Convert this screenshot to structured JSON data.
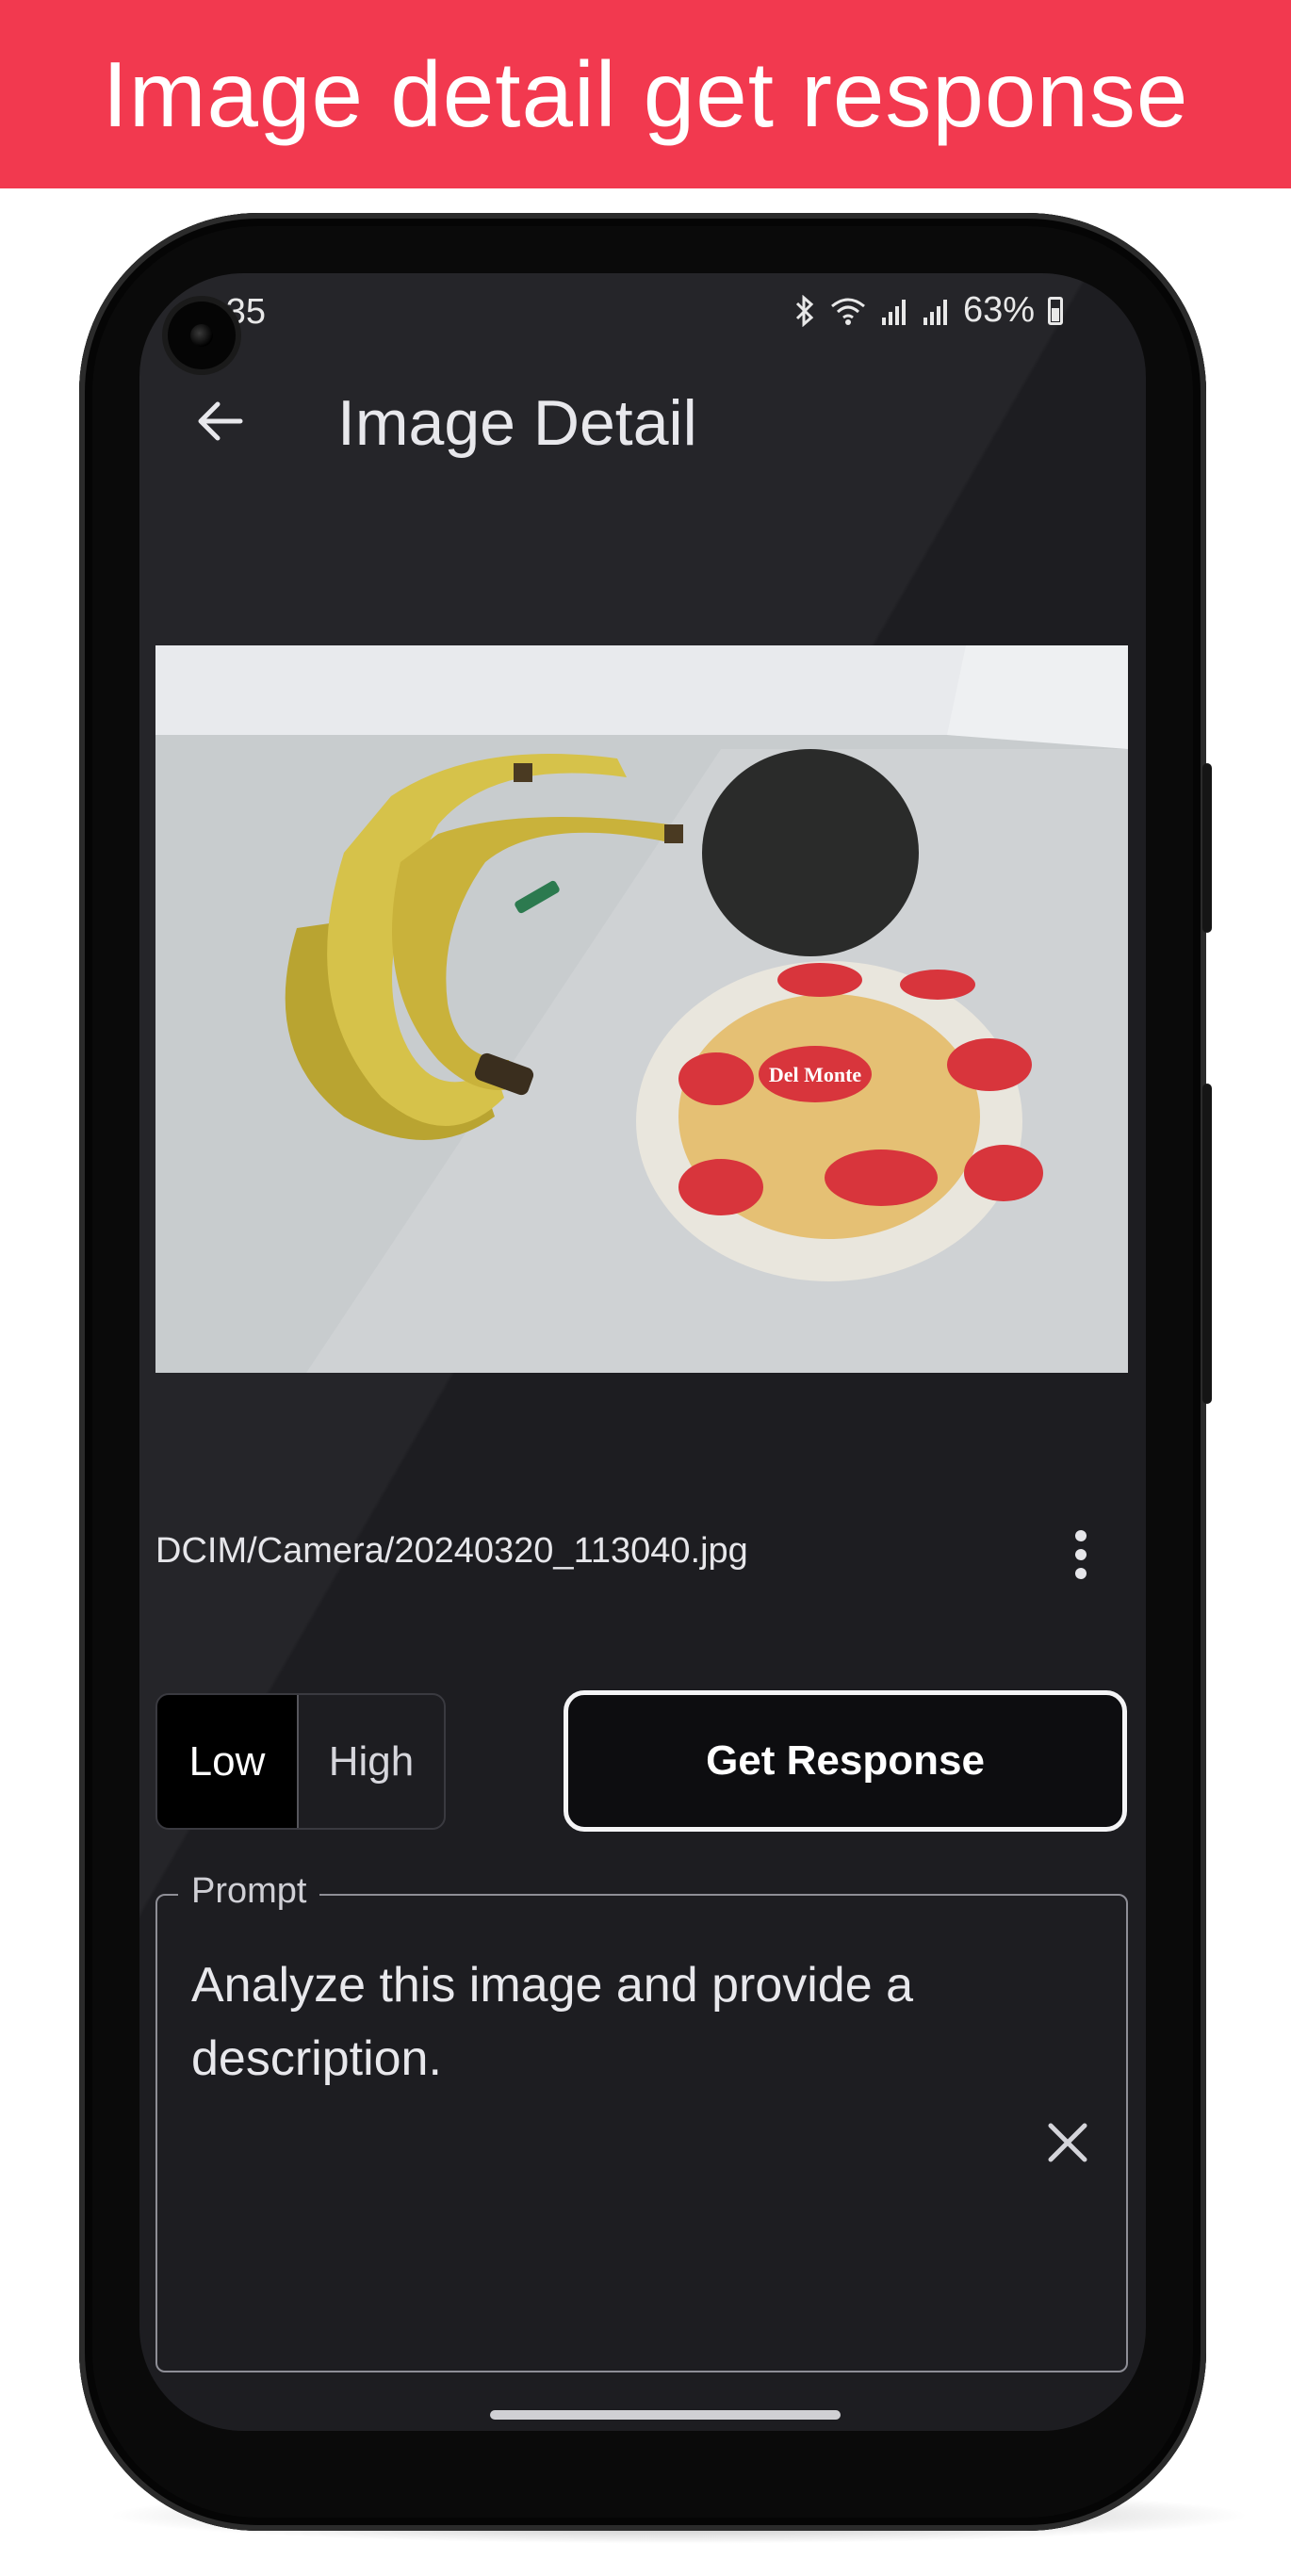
{
  "banner": {
    "title": "Image detail get response"
  },
  "status_bar": {
    "time": "3:35",
    "battery": "63%"
  },
  "app_bar": {
    "title": "Image Detail"
  },
  "image": {
    "file_path": "DCIM/Camera/20240320_113040.jpg",
    "brand_text": "Del Monte"
  },
  "quality_toggle": {
    "options": [
      "Low",
      "High"
    ],
    "selected": "Low"
  },
  "actions": {
    "get_response_label": "Get Response"
  },
  "prompt": {
    "label": "Prompt",
    "value": "Analyze this image and provide a description."
  },
  "colors": {
    "banner": "#f2394f",
    "screen_bg": "#1d1d21",
    "accent_white": "#ffffff"
  }
}
